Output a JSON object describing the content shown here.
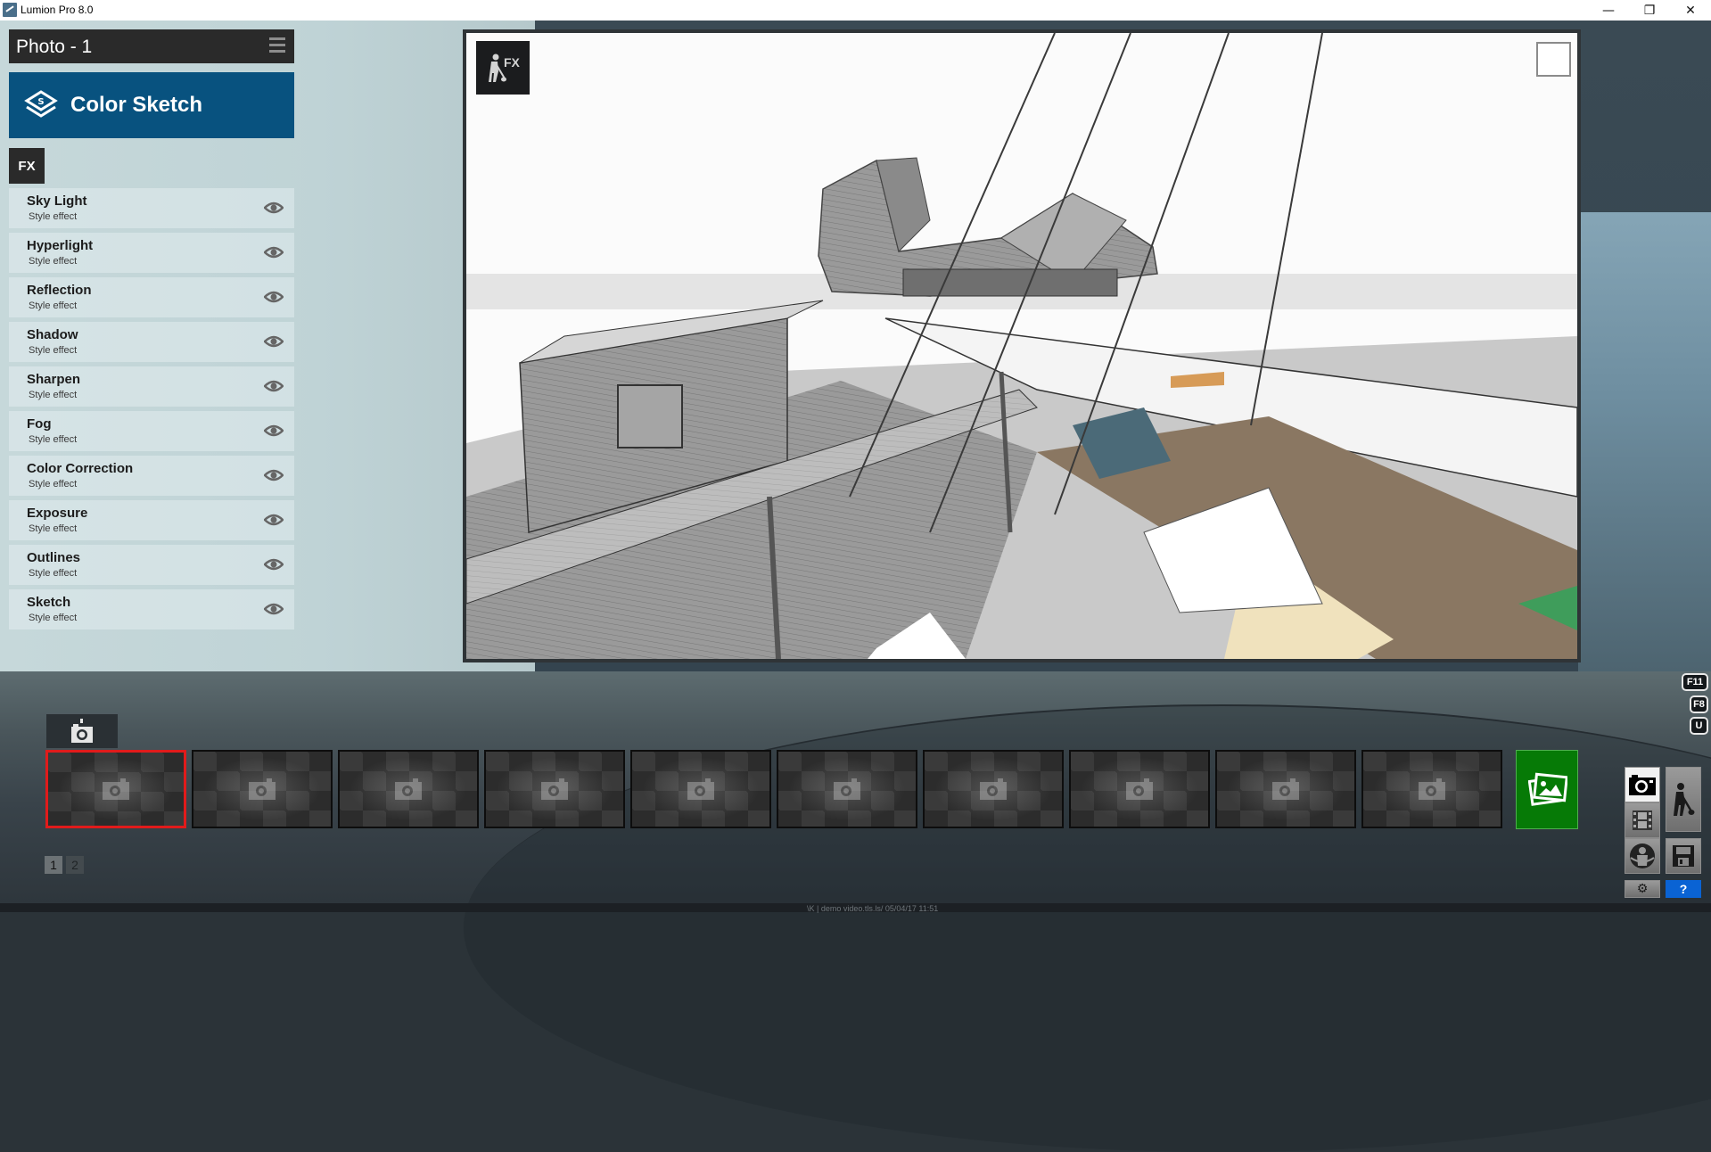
{
  "window": {
    "title": "Lumion Pro 8.0",
    "controls": {
      "minimize": "—",
      "restore": "❐",
      "close": "✕"
    }
  },
  "sidebar": {
    "photo_title": "Photo - 1",
    "style_name": "Color Sketch",
    "fx_tab_label": "FX",
    "effects": [
      {
        "name": "Sky Light",
        "type": "Style effect",
        "visible": true
      },
      {
        "name": "Hyperlight",
        "type": "Style effect",
        "visible": true
      },
      {
        "name": "Reflection",
        "type": "Style effect",
        "visible": true
      },
      {
        "name": "Shadow",
        "type": "Style effect",
        "visible": true
      },
      {
        "name": "Sharpen",
        "type": "Style effect",
        "visible": true
      },
      {
        "name": "Fog",
        "type": "Style effect",
        "visible": true
      },
      {
        "name": "Color Correction",
        "type": "Style effect",
        "visible": true
      },
      {
        "name": "Exposure",
        "type": "Style effect",
        "visible": true
      },
      {
        "name": "Outlines",
        "type": "Style effect",
        "visible": true
      },
      {
        "name": "Sketch",
        "type": "Style effect",
        "visible": true
      }
    ]
  },
  "viewport": {
    "fx_badge_label": "FX",
    "content": "Color sketch render of architectural scene"
  },
  "hotkeys": [
    "F11",
    "F8",
    "U"
  ],
  "filmstrip": {
    "slot_count": 10,
    "selected_index": 0,
    "pages": [
      "1",
      "2"
    ],
    "current_page": "1"
  },
  "toolbar": {
    "help_label": "?",
    "active_mode": "photo"
  },
  "status_strip": {
    "text": "\\K | demo video.tls.ls/     05/04/17  11:51"
  },
  "colors": {
    "style_banner": "#08527f",
    "selected_slot": "#e11b1b",
    "gallery_button": "#067a06",
    "help_button": "#0a63d4"
  }
}
